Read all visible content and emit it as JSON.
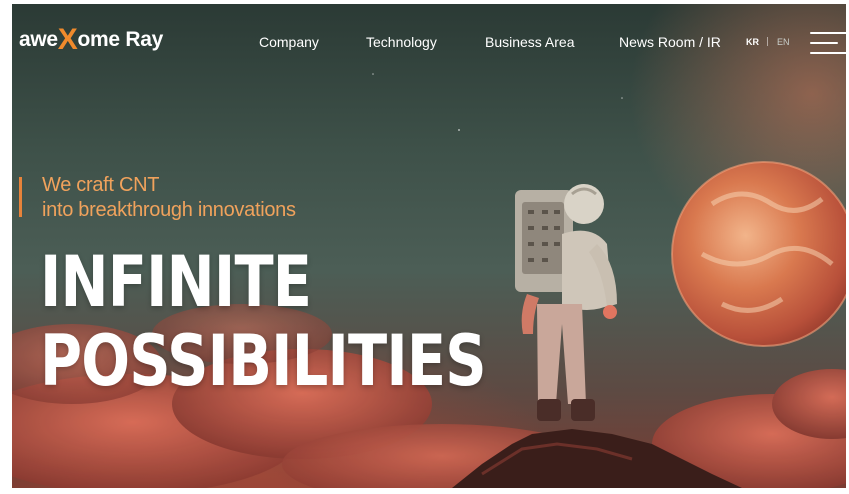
{
  "logo": {
    "prefix": "awe",
    "mark": "X",
    "suffix": "ome Ray"
  },
  "nav": {
    "items": [
      "Company",
      "Technology",
      "Business Area",
      "News Room / IR"
    ]
  },
  "language": {
    "options": [
      "KR",
      "EN"
    ],
    "active": "KR"
  },
  "hero": {
    "tagline_line1": "We craft CNT",
    "tagline_line2": "into breakthrough innovations",
    "headline_line1": "INFINITE",
    "headline_line2": "POSSIBILITIES"
  },
  "colors": {
    "accent": "#f08a2c",
    "tagline": "#f0a25c",
    "text": "#ffffff"
  },
  "icons": {
    "menu": "hamburger-menu-icon"
  }
}
